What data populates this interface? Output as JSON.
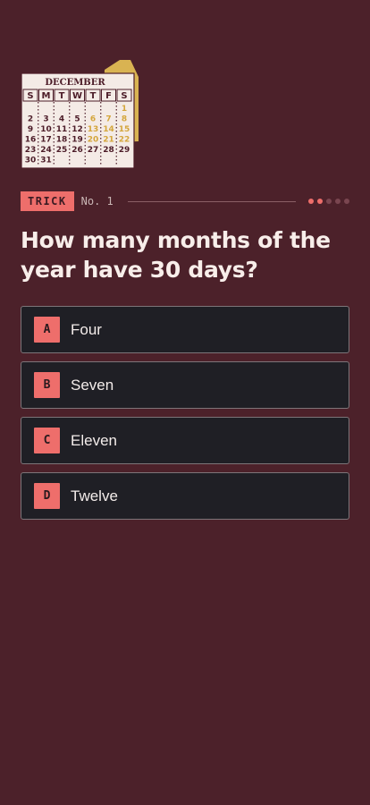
{
  "illustration": {
    "month": "DECEMBER",
    "weekdays": [
      "S",
      "M",
      "T",
      "W",
      "T",
      "F",
      "S"
    ],
    "days": [
      [
        "",
        "",
        "",
        "",
        "",
        "",
        "1"
      ],
      [
        "2",
        "3",
        "4",
        "5",
        "6",
        "7",
        "8"
      ],
      [
        "9",
        "10",
        "11",
        "12",
        "13",
        "14",
        "15"
      ],
      [
        "16",
        "17",
        "18",
        "19",
        "20",
        "21",
        "22"
      ],
      [
        "23",
        "24",
        "25",
        "26",
        "27",
        "28",
        "29"
      ],
      [
        "30",
        "31",
        "",
        "",
        "",
        "",
        ""
      ]
    ]
  },
  "meta": {
    "tag": "TRICK",
    "number": "No. 1"
  },
  "progress": {
    "total": 5,
    "completed": 2
  },
  "question": "How many months of the year have 30 days?",
  "options": [
    {
      "letter": "A",
      "text": "Four"
    },
    {
      "letter": "B",
      "text": "Seven"
    },
    {
      "letter": "C",
      "text": "Eleven"
    },
    {
      "letter": "D",
      "text": "Twelve"
    }
  ],
  "colors": {
    "background": "#4c212a",
    "accent": "#ee6e6b",
    "card": "#1f1f25",
    "calendar_paper": "#f4ebe6",
    "calendar_ink": "#4c1c28",
    "highlight": "#e9c356"
  }
}
